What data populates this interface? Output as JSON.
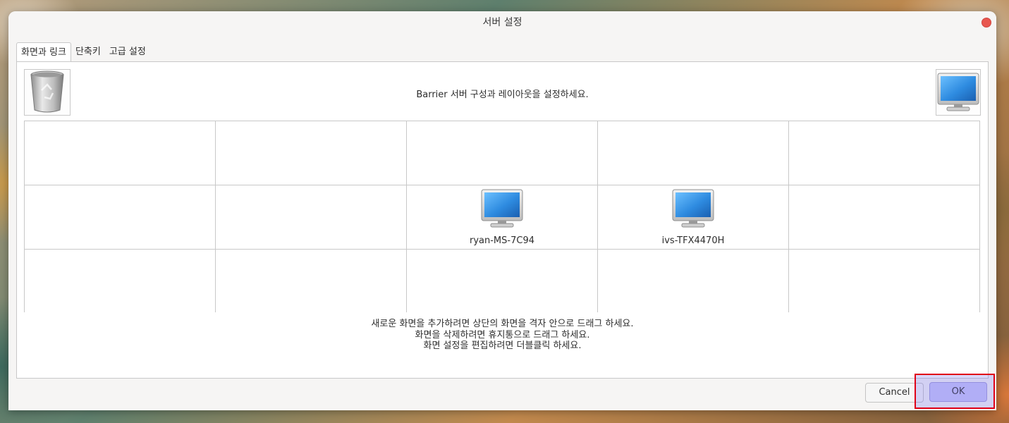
{
  "window": {
    "title": "서버 설정"
  },
  "tabs": [
    {
      "label": "화면과 링크",
      "active": true
    },
    {
      "label": "단축키",
      "active": false
    },
    {
      "label": "고급 설정",
      "active": false
    }
  ],
  "panel": {
    "header_text": "Barrier 서버 구성과 레이아웃을 설정하세요.",
    "trash_icon": "trash-can-icon",
    "new_screen_icon": "monitor-icon",
    "screens": [
      {
        "name": "ryan-MS-7C94",
        "icon": "monitor-icon"
      },
      {
        "name": "ivs-TFX4470H",
        "icon": "monitor-icon"
      }
    ],
    "help_lines": [
      "새로운 화면을 추가하려면 상단의 화면을 격자 안으로 드래그 하세요.",
      "화면을 삭제하려면 휴지통으로 드래그 하세요.",
      "화면 설정을 편집하려면 더블클릭 하세요."
    ]
  },
  "buttons": {
    "cancel": "Cancel",
    "ok": "OK"
  },
  "colors": {
    "close_button": "#e8574f",
    "ok_button": "#c8c6f8",
    "highlight_border": "#e00018",
    "monitor_screen": "#2e8be0"
  }
}
